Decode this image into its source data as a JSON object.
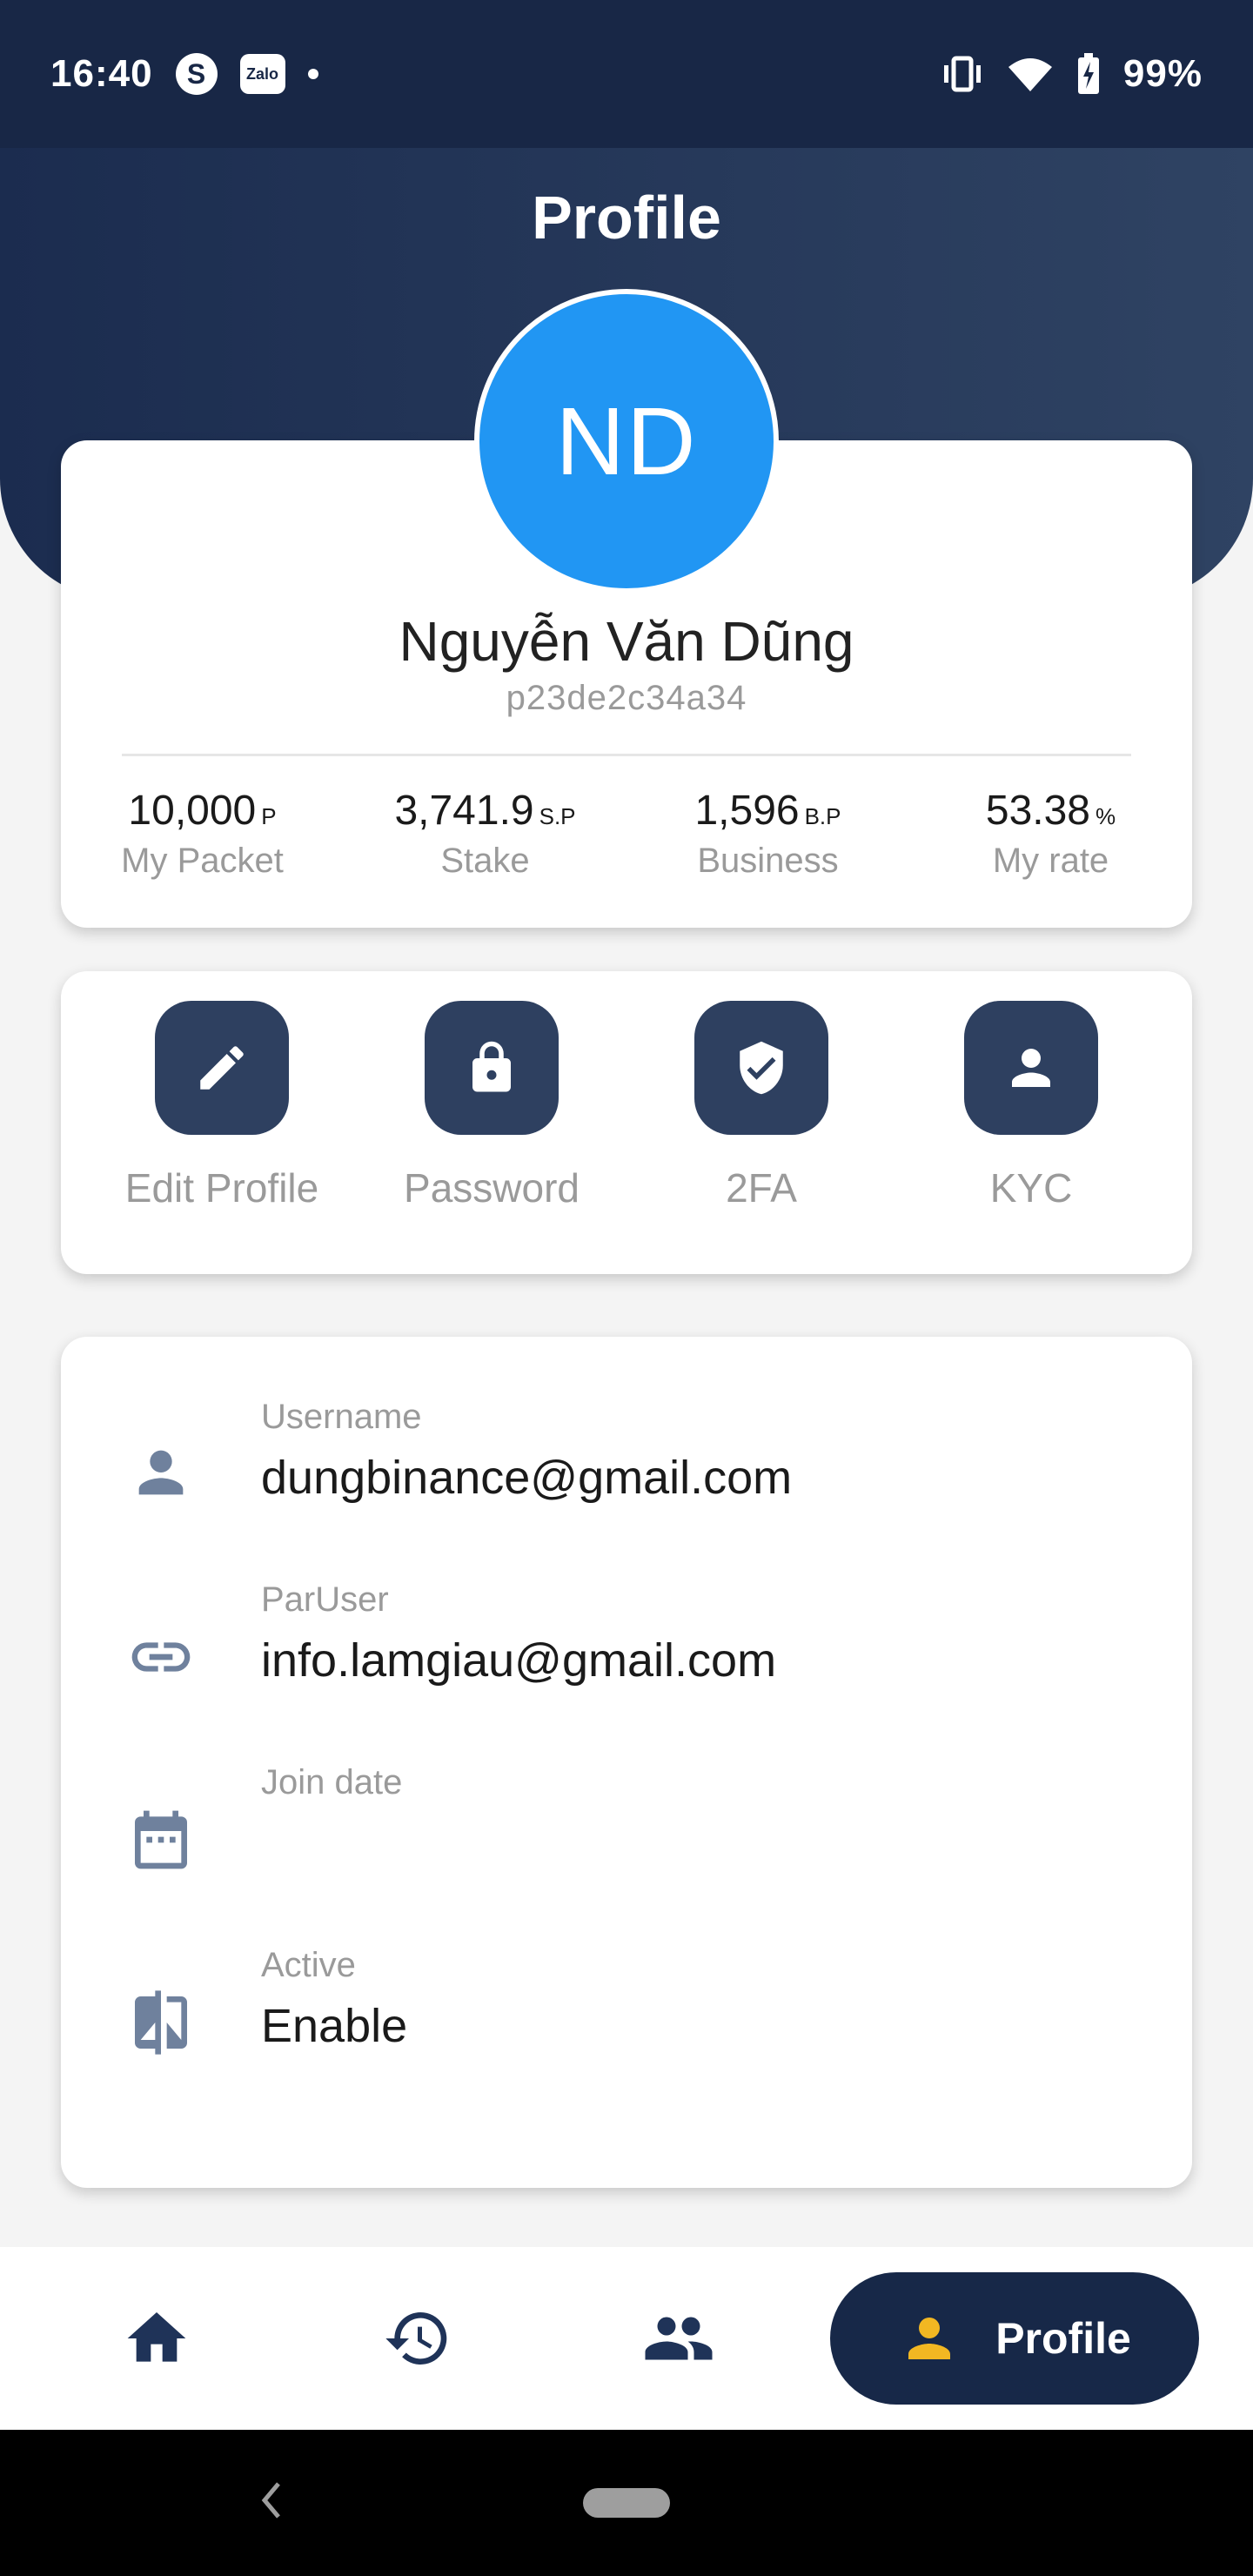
{
  "status_bar": {
    "time": "16:40",
    "battery": "99%",
    "zalo_label": "Zalo",
    "skype_label": "S",
    "icons": [
      "skype-icon",
      "zalo-icon",
      "notification-dot-icon",
      "vibrate-icon",
      "wifi-icon",
      "battery-charging-icon"
    ]
  },
  "header": {
    "title": "Profile"
  },
  "profile": {
    "initials": "ND",
    "name": "Nguyễn Văn Dũng",
    "code": "p23de2c34a34",
    "avatar_color": "#2196f3",
    "stats": [
      {
        "value": "10,000",
        "unit": "P",
        "label": "My Packet"
      },
      {
        "value": "3,741.9",
        "unit": "S.P",
        "label": "Stake"
      },
      {
        "value": "1,596",
        "unit": "B.P",
        "label": "Business"
      },
      {
        "value": "53.38",
        "unit": "%",
        "label": "My rate"
      }
    ]
  },
  "actions": [
    {
      "label": "Edit Profile",
      "icon": "pencil-icon"
    },
    {
      "label": "Password",
      "icon": "lock-icon"
    },
    {
      "label": "2FA",
      "icon": "shield-check-icon"
    },
    {
      "label": "KYC",
      "icon": "person-icon"
    }
  ],
  "info": [
    {
      "label": "Username",
      "value": "dungbinance@gmail.com",
      "icon": "person-icon"
    },
    {
      "label": "ParUser",
      "value": "info.lamgiau@gmail.com",
      "icon": "link-icon"
    },
    {
      "label": "Join date",
      "value": "",
      "icon": "calendar-icon"
    },
    {
      "label": "Active",
      "value": "Enable",
      "icon": "compare-icon"
    }
  ],
  "bottom_nav": {
    "items": [
      "home-icon",
      "history-icon",
      "people-icon"
    ],
    "active_label": "Profile",
    "active_icon": "person-icon"
  },
  "colors": {
    "navy": "#182746",
    "button": "#2e4060",
    "icon_grey": "#6f819d",
    "accent_yellow": "#f2b722"
  }
}
